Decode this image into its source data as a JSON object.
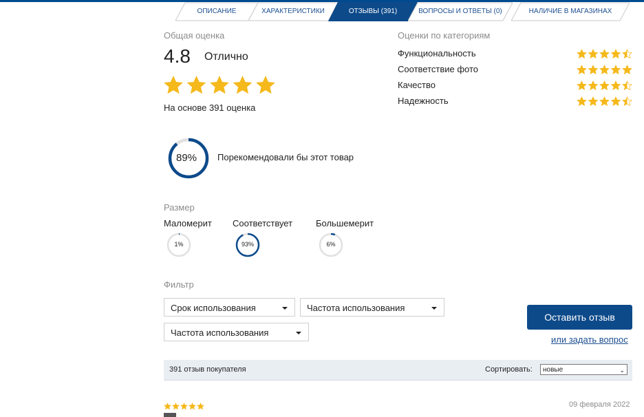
{
  "tabs": [
    {
      "label": "Описание",
      "active": false
    },
    {
      "label": "Характеристики",
      "active": false
    },
    {
      "label": "Отзывы (391)",
      "active": true
    },
    {
      "label": "Вопросы и ответы (0)",
      "active": false
    },
    {
      "label": "Наличие в магазинах",
      "active": false
    }
  ],
  "overall": {
    "heading": "Общая оценка",
    "score": "4.8",
    "word": "Отлично",
    "based_on": "На основе 391 оценка",
    "stars": 5
  },
  "categories": {
    "heading": "Оценки по категориям",
    "items": [
      {
        "label": "Функциональность",
        "stars": 4.5
      },
      {
        "label": "Соответствие фото",
        "stars": 5
      },
      {
        "label": "Качество",
        "stars": 4.5
      },
      {
        "label": "Надежность",
        "stars": 4.5
      }
    ]
  },
  "recommend": {
    "percent": "89%",
    "value": 0.89,
    "text": "Порекомендовали бы этот товар"
  },
  "size": {
    "heading": "Размер",
    "options": [
      {
        "label": "Маломерит",
        "percent": "1%",
        "value": 0.01
      },
      {
        "label": "Соответствует",
        "percent": "93%",
        "value": 0.93
      },
      {
        "label": "Большемерит",
        "percent": "6%",
        "value": 0.06
      }
    ]
  },
  "filter": {
    "heading": "Фильтр",
    "selects": [
      "Срок использования",
      "Частота использования",
      "Частота использования"
    ]
  },
  "actions": {
    "leave_review": "Оставить отзыв",
    "ask_question": "или задать вопрос"
  },
  "list": {
    "count": "391 отзыв покупателя",
    "sort_label": "Сортировать:",
    "sort_value": "новые"
  },
  "review": {
    "stars": 5,
    "date": "09 февраля 2022"
  },
  "colors": {
    "brand": "#0d4a8a",
    "star": "#f5b91c",
    "ring_track": "#e1e1e1"
  }
}
